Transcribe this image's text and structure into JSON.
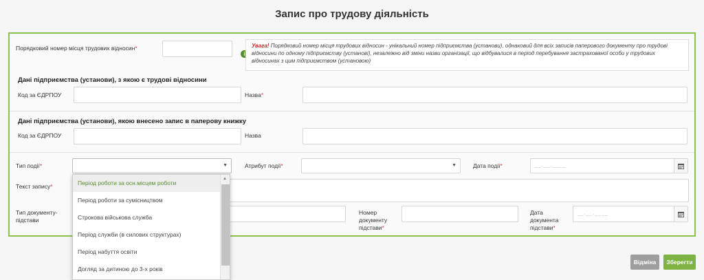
{
  "modal": {
    "title": "Запис про трудову діяльність"
  },
  "fields": {
    "order_number": {
      "label": "Порядковий номер місця трудових відносин",
      "required_mark": "*"
    },
    "notice": {
      "strong": "Увага!",
      "text": "Порядковий номер місця трудових відносин - унікальний номер підприємства (установи), однаковий для всіх записів паперового документу про трудові відносини по одному підприємству (установі), незалежно від зміни назви організації, що відбувалися в період перебування застрахованої особи у трудових відносинах з цим підприємством (установою)"
    },
    "section1": {
      "title": "Дані підприємства (установи), з якою є трудові відносини",
      "code_label": "Код за ЄДРПОУ",
      "name_label": "Назва",
      "name_required": "*"
    },
    "section2": {
      "title": "Дані підприємства (установи), якою внесено запис в паперову книжку",
      "code_label": "Код за ЄДРПОУ",
      "name_label": "Назва"
    },
    "event_type": {
      "label": "Тип події",
      "required_mark": "*"
    },
    "event_attr": {
      "label": "Атрибут події",
      "required_mark": "*"
    },
    "event_date": {
      "label": "Дата події",
      "required_mark": "*",
      "placeholder": "__.__.____"
    },
    "record_text": {
      "label": "Текст запису",
      "required_mark": "*"
    },
    "doc_type": {
      "label_line1": "Тип документу-",
      "label_line2": "підстави"
    },
    "doc_number": {
      "label_line1": "Номер",
      "label_line2": "документу",
      "label_line3": "підстави",
      "required_mark": "*"
    },
    "doc_date": {
      "label_line1": "Дата",
      "label_line2": "документа",
      "label_line3": "підстави",
      "required_mark": "*",
      "placeholder": "__.__.____"
    }
  },
  "dropdown": {
    "items": [
      "Період роботи за осн.місцем роботи",
      "Період роботи за сумісництвом",
      "Строкова військова служба",
      "Період служби (в силових структурах)",
      "Період набуття освіти",
      "Догляд за дитиною до 3-х років"
    ],
    "active_index": 0
  },
  "buttons": {
    "cancel": "Відміна",
    "save": "Зберегти"
  },
  "colors": {
    "accent": "#8bc34a",
    "save": "#7cb342",
    "required": "#e53935",
    "notice_strong": "#c62828"
  }
}
